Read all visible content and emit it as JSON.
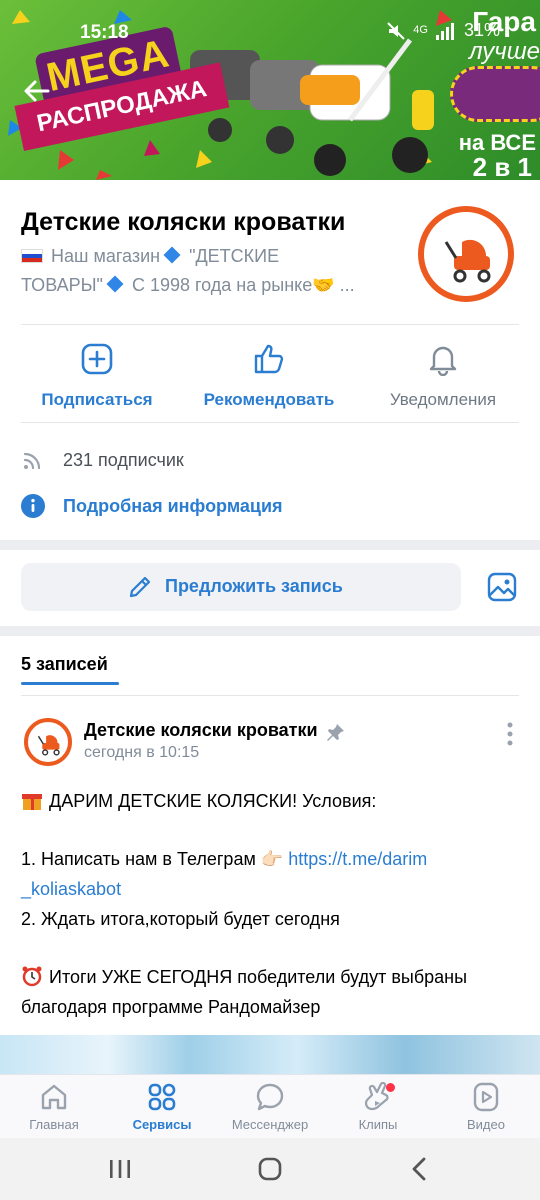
{
  "status_bar": {
    "time": "15:18",
    "network": "4G",
    "battery": "31%"
  },
  "cover": {
    "mega_text": "MEGA",
    "sale_text": "РАСПРОДАЖА",
    "promo_line_1": "Гара",
    "promo_line_2": "лучше",
    "promo_line_3": "на ВСЕ",
    "promo_line_4": "2 в 1"
  },
  "group": {
    "title": "Детские коляски кроватки",
    "description_line_1_a": "Наш магазин",
    "description_line_1_b": "\"ДЕТСКИЕ",
    "description_line_2": "ТОВАРЫ\"",
    "description_line_2_b": "С 1998 года на рынке🤝 ..."
  },
  "actions": {
    "subscribe": "Подписаться",
    "recommend": "Рекомендовать",
    "notifications": "Уведомления"
  },
  "info": {
    "subscribers": "231 подписчик",
    "details": "Подробная информация"
  },
  "suggest": {
    "label": "Предложить запись"
  },
  "posts": {
    "tab_label": "5 записей",
    "author": "Детские коляски кроватки",
    "time": "сегодня в 10:15",
    "line_1": "ДАРИМ ДЕТСКИЕ КОЛЯСКИ! Условия:",
    "line_2_text": "1. Написать нам в Телеграм 👉🏻 ",
    "line_2_link": "https://t.me/darim",
    "line_3_link": "_koliaskabot",
    "line_4": "2. Ждать итога,который будет сегодня",
    "line_5": "Итоги УЖЕ СЕГОДНЯ победители будут выбраны",
    "line_6": "благодаря программе Рандомайзер"
  },
  "bottom_nav": {
    "items": [
      {
        "label": "Главная",
        "icon": "home-icon"
      },
      {
        "label": "Сервисы",
        "icon": "services-icon"
      },
      {
        "label": "Мессенджер",
        "icon": "messenger-icon"
      },
      {
        "label": "Клипы",
        "icon": "clips-icon"
      },
      {
        "label": "Видео",
        "icon": "video-icon"
      }
    ],
    "active_index": 1
  },
  "colors": {
    "accent": "#2a7dd1",
    "brand_orange": "#ec5a1f",
    "secondary_text": "#818c99",
    "badge": "#ff3347"
  }
}
